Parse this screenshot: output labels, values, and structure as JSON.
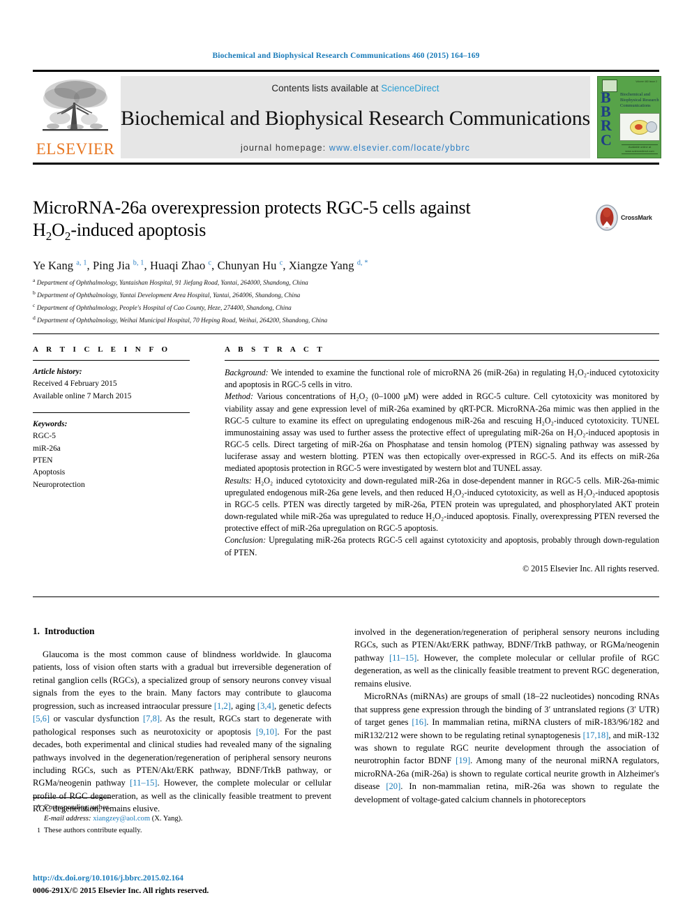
{
  "running_head": "Biochemical and Biophysical Research Communications 460 (2015) 164–169",
  "masthead": {
    "publisher_name": "ELSEVIER",
    "contents_prefix": "Contents lists available at ",
    "contents_link": "ScienceDirect",
    "journal_title": "Biochemical and Biophysical Research Communications",
    "homepage_prefix": "journal homepage: ",
    "homepage_url": "www.elsevier.com/locate/ybbrc",
    "cover": {
      "bbrc_letters": "B\nB\nR\nC",
      "cover_title": "Biochemical and Biophysical Research Communications",
      "cover_top_right": "Volume 460 Issue 2",
      "cover_footer": "Available online at www.sciencedirect.com",
      "background_color": "#57a349"
    },
    "link_color": "#2b9fd4"
  },
  "article": {
    "title_line1": "MicroRNA-26a overexpression protects RGC-5 cells against",
    "title_line2_pre": "H",
    "title_line2_sub1": "2",
    "title_line2_mid": "O",
    "title_line2_sub2": "2",
    "title_line2_post": "-induced apoptosis",
    "crossmark_label": "CrossMark",
    "authors": [
      {
        "name": "Ye Kang",
        "sup": "a, 1"
      },
      {
        "name": "Ping Jia",
        "sup": "b, 1"
      },
      {
        "name": "Huaqi Zhao",
        "sup": "c"
      },
      {
        "name": "Chunyan Hu",
        "sup": "c"
      },
      {
        "name": "Xiangze Yang",
        "sup": "d, *"
      }
    ],
    "affiliations": [
      {
        "mark": "a",
        "text": "Department of Ophthalmology, Yantaishan Hospital, 91 Jiefang Road, Yantai, 264000, Shandong, China"
      },
      {
        "mark": "b",
        "text": "Department of Ophthalmology, Yantai Development Area Hospital, Yantai, 264006, Shandong, China"
      },
      {
        "mark": "c",
        "text": "Department of Ophthalmology, People's Hospital of Cao County, Heze, 274400, Shandong, China"
      },
      {
        "mark": "d",
        "text": "Department of Ophthalmology, Weihai Municipal Hospital, 70 Heping Road, Weihai, 264200, Shandong, China"
      }
    ]
  },
  "article_info": {
    "heading": "A R T I C L E   I N F O",
    "history_label": "Article history:",
    "history": [
      "Received 4 February 2015",
      "Available online 7 March 2015"
    ],
    "keywords_label": "Keywords:",
    "keywords": [
      "RGC-5",
      "miR-26a",
      "PTEN",
      "Apoptosis",
      "Neuroprotection"
    ]
  },
  "abstract": {
    "heading": "A B S T R A C T",
    "background_label": "Background:",
    "background_text": " We intended to examine the functional role of microRNA 26 (miR-26a) in regulating H₂O₂-induced cytotoxicity and apoptosis in RGC-5 cells in vitro.",
    "method_label": "Method:",
    "method_text": " Various concentrations of H₂O₂ (0–1000 μM) were added in RGC-5 culture. Cell cytotoxicity was monitored by viability assay and gene expression level of miR-26a examined by qRT-PCR. MicroRNA-26a mimic was then applied in the RGC-5 culture to examine its effect on upregulating endogenous miR-26a and rescuing H₂O₂-induced cytotoxicity. TUNEL immunostaining assay was used to further assess the protective effect of upregulating miR-26a on H₂O₂-induced apoptosis in RGC-5 cells. Direct targeting of miR-26a on Phosphatase and tensin homolog (PTEN) signaling pathway was assessed by luciferase assay and western blotting. PTEN was then ectopically over-expressed in RGC-5. And its effects on miR-26a mediated apoptosis protection in RGC-5 were investigated by western blot and TUNEL assay.",
    "results_label": "Results:",
    "results_text": " H₂O₂ induced cytotoxicity and down-regulated miR-26a in dose-dependent manner in RGC-5 cells. MiR-26a-mimic upregulated endogenous miR-26a gene levels, and then reduced H₂O₂-induced cytotoxicity, as well as H₂O₂-induced apoptosis in RGC-5 cells. PTEN was directly targeted by miR-26a, PTEN protein was upregulated, and phosphorylated AKT protein down-regulated while miR-26a was upregulated to reduce H₂O₂-induced apoptosis. Finally, overexpressing PTEN reversed the protective effect of miR-26a upregulation on RGC-5 apoptosis.",
    "conclusion_label": "Conclusion:",
    "conclusion_text": " Upregulating miR-26a protects RGC-5 cell against cytotoxicity and apoptosis, probably through down-regulation of PTEN.",
    "copyright": "© 2015 Elsevier Inc. All rights reserved."
  },
  "introduction": {
    "number": "1.",
    "heading": "Introduction",
    "para1_a": "Glaucoma is the most common cause of blindness worldwide. In glaucoma patients, loss of vision often starts with a gradual but irreversible degeneration of retinal ganglion cells (RGCs), a specialized group of sensory neurons convey visual signals from the eyes to the brain. Many factors may contribute to glaucoma progression, such as increased intraocular pressure ",
    "ref1": "[1,2]",
    "para1_b": ", aging ",
    "ref2": "[3,4]",
    "para1_c": ", genetic defects ",
    "ref3": "[5,6]",
    "para1_d": " or vascular dysfunction ",
    "ref4": "[7,8]",
    "para1_e": ". As the result, RGCs start to degenerate with pathological responses such as neurotoxicity or apoptosis ",
    "ref5": "[9,10]",
    "para1_f": ". For the past decades, both experimental and clinical studies had revealed many of the signaling pathways involved in the degeneration/regeneration of peripheral sensory neurons including RGCs, such as PTEN/Akt/ERK pathway, BDNF/TrkB pathway, or RGMa/neogenin pathway ",
    "ref6": "[11–15]",
    "para1_g": ". However, the complete molecular or cellular profile of RGC degeneration, as well as the clinically feasible treatment to prevent RGC degeneration, remains elusive.",
    "para2_a": "MicroRNAs (miRNAs) are groups of small (18–22 nucleotides) noncoding RNAs that suppress gene expression through the binding of 3′ untranslated regions (3′ UTR) of target genes ",
    "ref7": "[16]",
    "para2_b": ". In mammalian retina, miRNA clusters of miR-183/96/182 and miR132/212 were shown to be regulating retinal synaptogenesis ",
    "ref8": "[17,18]",
    "para2_c": ", and miR-132 was shown to regulate RGC neurite development through the association of neurotrophin factor BDNF ",
    "ref9": "[19]",
    "para2_d": ". Among many of the neuronal miRNA regulators, microRNA-26a (miR-26a) is shown to regulate cortical neurite growth in Alzheimer's disease ",
    "ref10": "[20]",
    "para2_e": ". In non-mammalian retina, miR-26a was shown to regulate the development of voltage-gated calcium channels in photoreceptors"
  },
  "footnotes": {
    "corresponding_mark": "*",
    "corresponding_text": "Corresponding author.",
    "email_label": "E-mail address:",
    "email": "xiangzey@aol.com",
    "email_suffix": "(X. Yang).",
    "equal_mark": "1",
    "equal_text": "These authors contribute equally."
  },
  "footer": {
    "doi": "http://dx.doi.org/10.1016/j.bbrc.2015.02.164",
    "issn_line": "0006-291X/© 2015 Elsevier Inc. All rights reserved.",
    "link_color": "#1a7bb9"
  }
}
